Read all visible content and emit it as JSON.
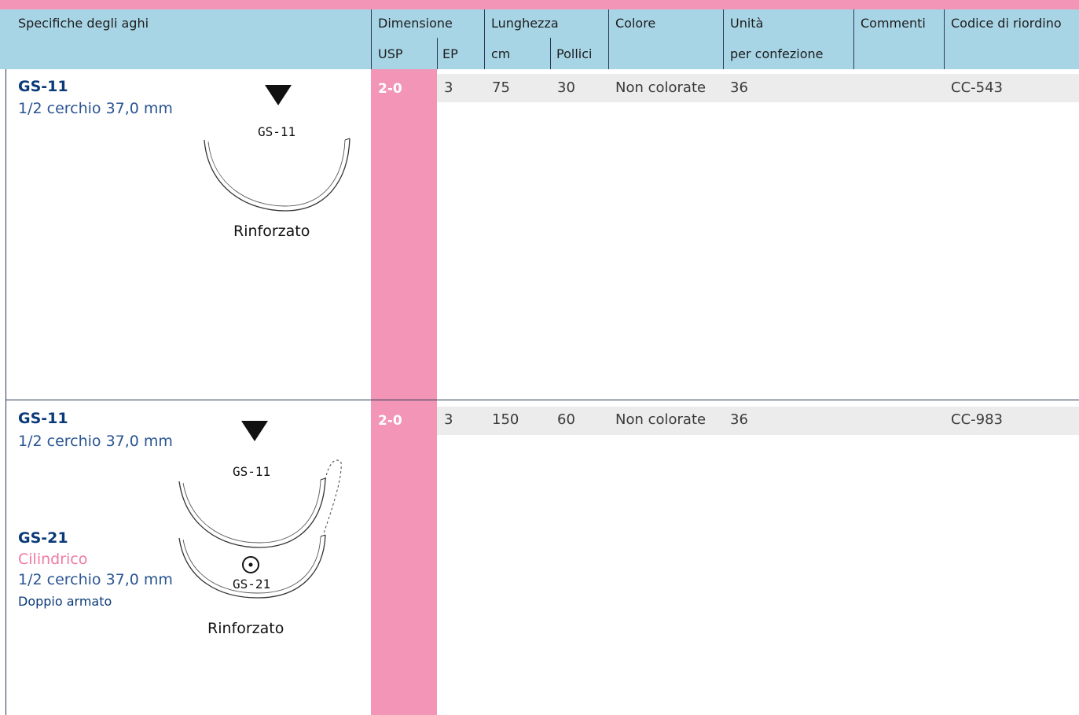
{
  "header": {
    "specs": "Specifiche degli aghi",
    "dimensione": "Dimensione",
    "usp": "USP",
    "ep": "EP",
    "lunghezza": "Lunghezza",
    "cm": "cm",
    "pollici": "Pollici",
    "colore": "Colore",
    "unita": "Unità",
    "per_confezione": "per confezione",
    "commenti": "Commenti",
    "codice": "Codice di riordino"
  },
  "rows": [
    {
      "code": "GS-11",
      "desc": "1/2 cerchio   37,0 mm",
      "needle_label": "GS-11",
      "caption": "Rinforzato",
      "usp": "2-0",
      "ep": "3",
      "cm": "75",
      "pollici": "30",
      "colore": "Non colorate",
      "unita": "36",
      "codice": "CC-543"
    },
    {
      "code": "GS-11",
      "desc": "1/2 cerchio   37,0 mm",
      "needle_label": "GS-11",
      "code2": "GS-21",
      "type2": "Cilindrico",
      "desc2": "1/2 cerchio   37,0 mm",
      "double": "Doppio armato",
      "needle_label2": "GS-21",
      "caption": "Rinforzato",
      "usp": "2-0",
      "ep": "3",
      "cm": "150",
      "pollici": "60",
      "colore": "Non colorate",
      "unita": "36",
      "codice": "CC-983"
    }
  ],
  "icons": [
    "triangle-down-icon",
    "circle-dot-icon"
  ]
}
